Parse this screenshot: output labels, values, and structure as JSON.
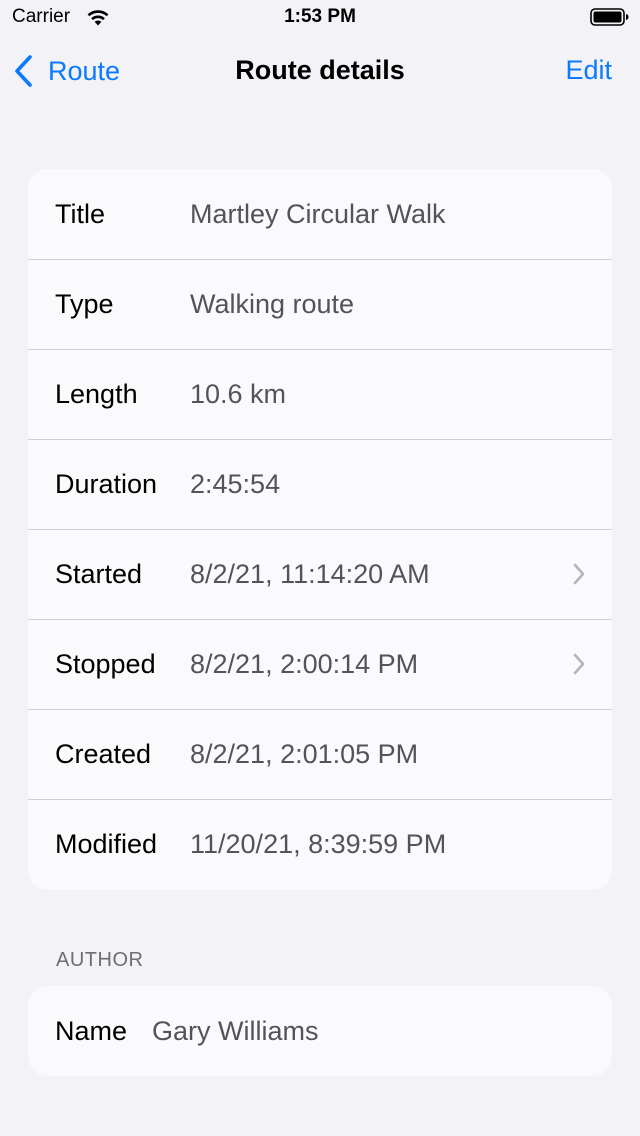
{
  "status_bar": {
    "carrier": "Carrier",
    "time": "1:53 PM"
  },
  "nav": {
    "back_label": "Route",
    "title": "Route details",
    "edit_label": "Edit"
  },
  "details": {
    "rows": [
      {
        "label": "Title",
        "value": "Martley Circular Walk"
      },
      {
        "label": "Type",
        "value": "Walking route"
      },
      {
        "label": "Length",
        "value": "10.6 km"
      },
      {
        "label": "Duration",
        "value": "2:45:54"
      },
      {
        "label": "Started",
        "value": "8/2/21, 11:14:20 AM"
      },
      {
        "label": "Stopped",
        "value": "8/2/21, 2:00:14 PM"
      },
      {
        "label": "Created",
        "value": "8/2/21, 2:01:05 PM"
      },
      {
        "label": "Modified",
        "value": "11/20/21, 8:39:59 PM"
      }
    ]
  },
  "author": {
    "header": "AUTHOR",
    "name_label": "Name",
    "name_value": "Gary Williams"
  },
  "colors": {
    "accent": "#0a7aff",
    "background": "#f2f2f7",
    "card": "#fafafc",
    "secondary_text": "#545458"
  },
  "icons": [
    "wifi-icon",
    "battery-icon",
    "chevron-left-icon",
    "chevron-right-icon"
  ]
}
